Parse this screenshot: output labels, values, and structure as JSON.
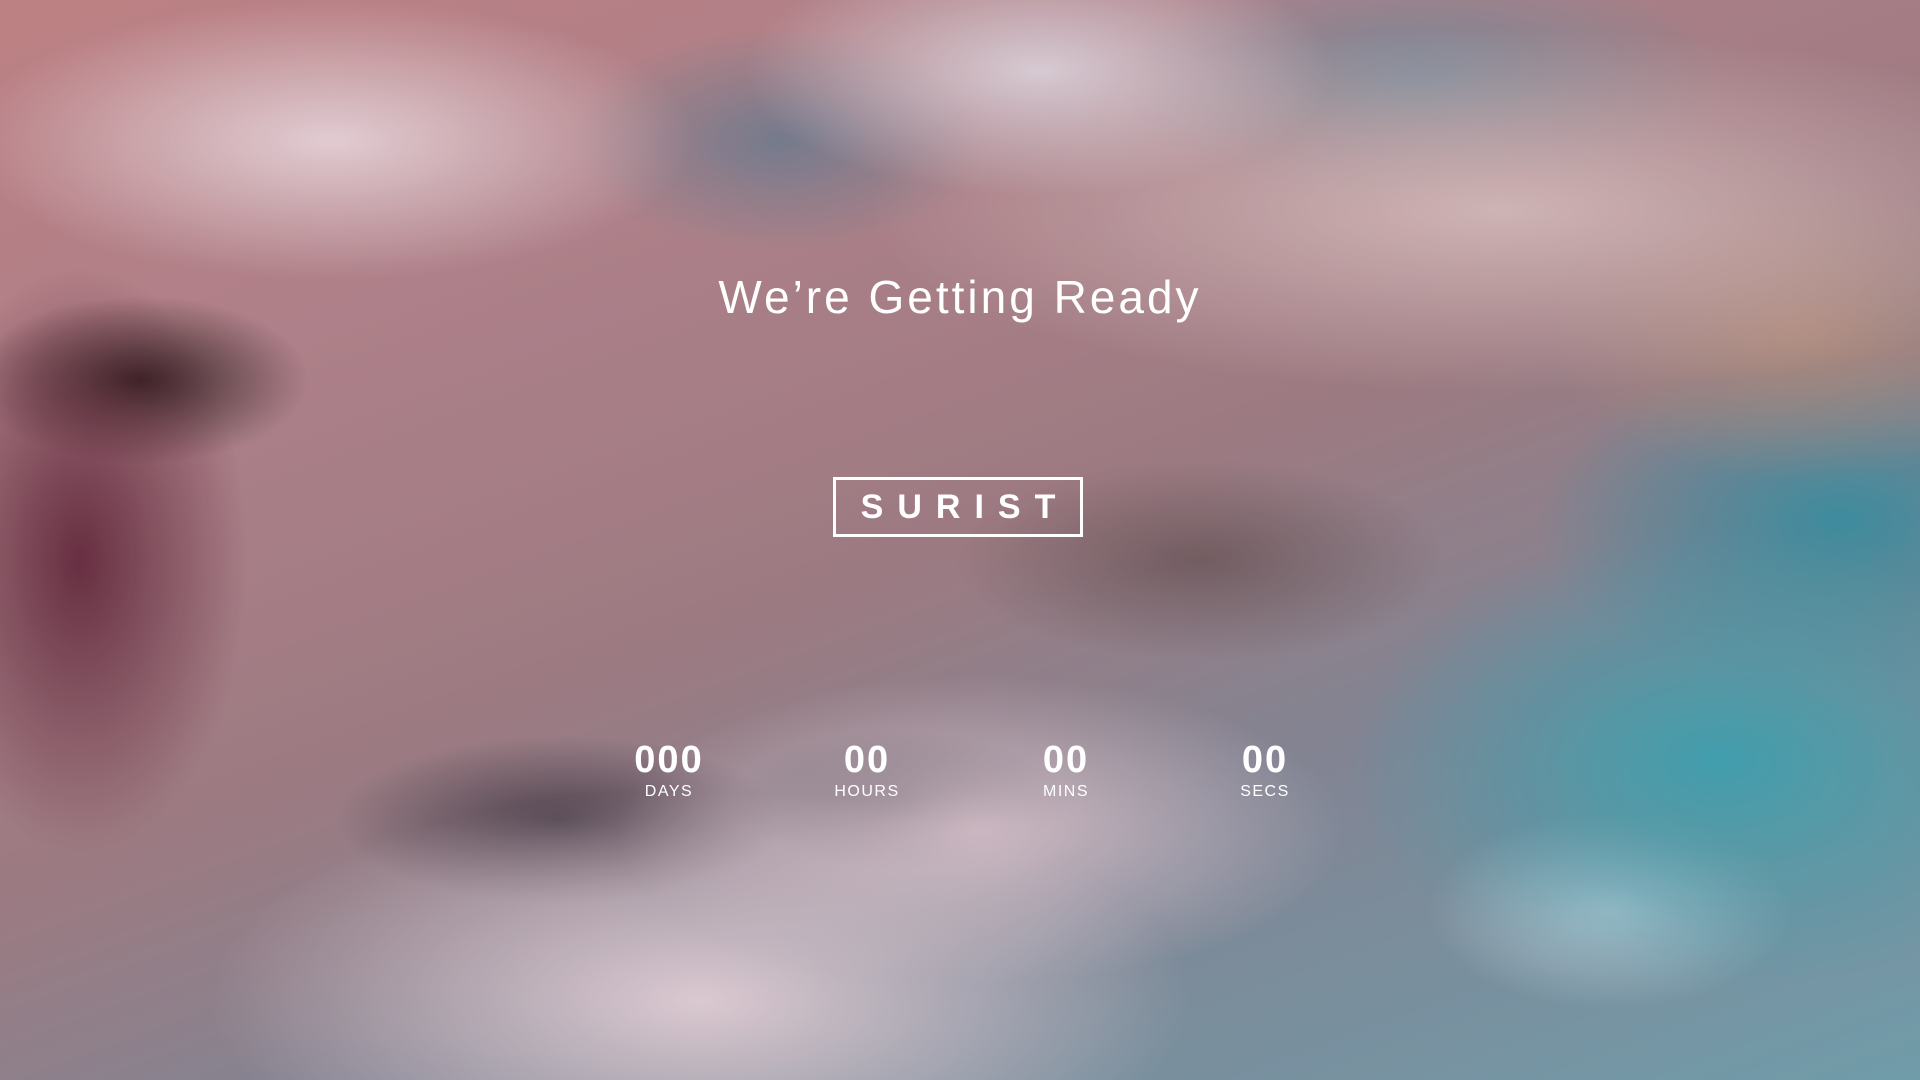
{
  "headline": "We’re Getting Ready",
  "logo": {
    "text": "SURIST"
  },
  "countdown": [
    {
      "value": "000",
      "label": "DAYS"
    },
    {
      "value": "00",
      "label": "HOURS"
    },
    {
      "value": "00",
      "label": "MINS"
    },
    {
      "value": "00",
      "label": "SECS"
    }
  ],
  "colors": {
    "text": "#ffffff"
  }
}
